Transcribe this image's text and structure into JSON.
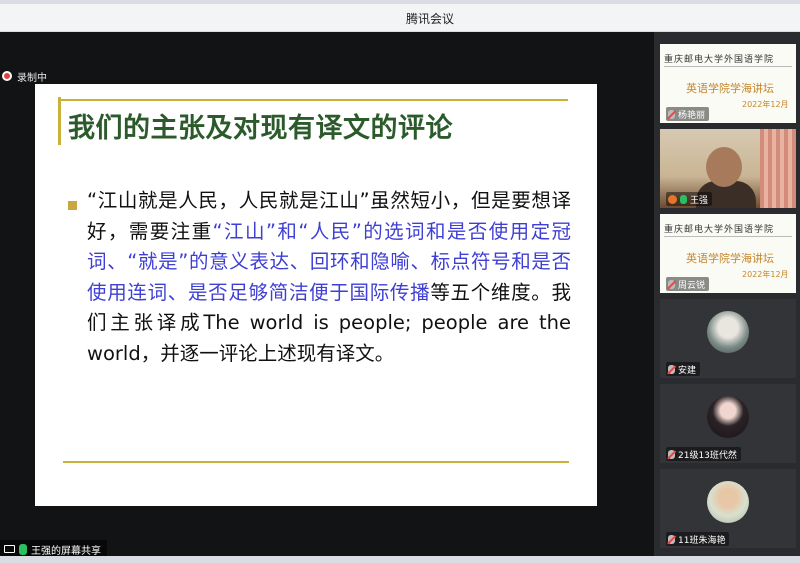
{
  "window": {
    "app_title": "腾讯会议"
  },
  "recording": {
    "label": "录制中"
  },
  "slide": {
    "title": "我们的主张及对现有译文的评论",
    "body_parts": [
      "“江山就是人民，人民就是江山”虽然短小，但是要想译好，需要注重",
      "“江山”和“人民”的选词和是否使用定冠词、“就是”的意义表达、回环和隐喻、标点符号和是否使用连词、是否足够简洁便于国际传播",
      "等五个维度。我们主张译成The world is people; people are the world，并逐一评论上述现有译文。"
    ]
  },
  "share": {
    "label": "王强的屏幕共享"
  },
  "participants": [
    {
      "name": "杨艳丽",
      "crest": "重庆邮电大学外国语学院",
      "event": "英语学院学海讲坛",
      "date": "2022年12月",
      "mic": "off"
    },
    {
      "name": "王强",
      "mic": "on"
    },
    {
      "name": "周云锐",
      "crest": "重庆邮电大学外国语学院",
      "event": "英语学院学海讲坛",
      "date": "2022年12月",
      "mic": "off"
    },
    {
      "name": "安建",
      "mic": "off"
    },
    {
      "name": "21级13班代然",
      "mic": "off"
    },
    {
      "name": "11班朱海艳",
      "mic": "off"
    }
  ],
  "colors": {
    "accent_gold": "#c9b23b",
    "title_green": "#2b5a2b",
    "highlight_blue": "#3f3fd6",
    "recording_red": "#e0413a",
    "mic_on_green": "#2bbf62"
  }
}
